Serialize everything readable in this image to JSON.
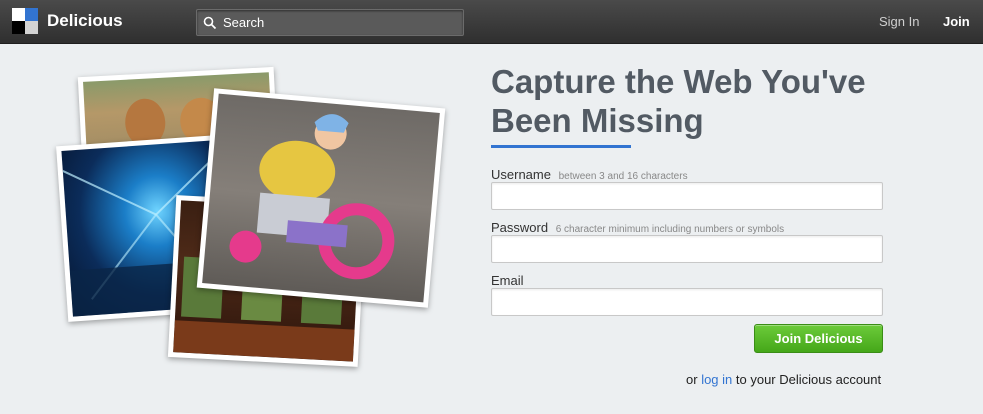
{
  "header": {
    "brand": "Delicious",
    "search_placeholder": "Search",
    "signin_label": "Sign In",
    "join_label": "Join"
  },
  "hero": {
    "title_line1": "Capture the Web You've",
    "title_line2": "Been Missing"
  },
  "form": {
    "username_label": "Username",
    "username_hint": "between 3 and 16 characters",
    "password_label": "Password",
    "password_hint": "6 character minimum including numbers or symbols",
    "email_label": "Email",
    "submit_label": "Join Delicious",
    "login_prefix": "or",
    "login_link": "log in",
    "login_suffix": "to your Delicious account"
  },
  "colors": {
    "accent_blue": "#3274d1",
    "button_green": "#55b52a",
    "heading_gray": "#525a63"
  },
  "icons": [
    "search-icon",
    "delicious-logo-icon"
  ]
}
